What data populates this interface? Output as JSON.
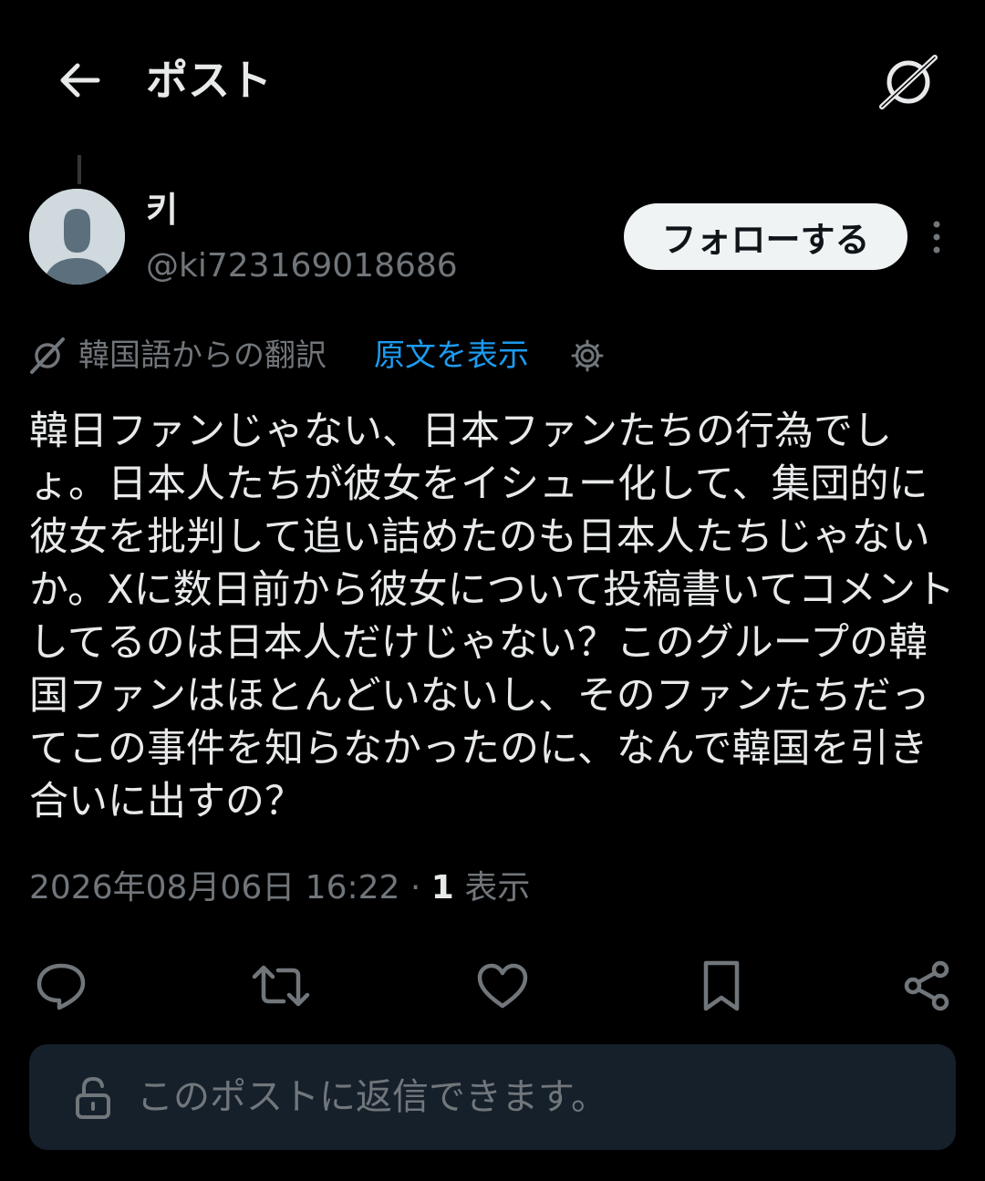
{
  "header": {
    "title": "ポスト",
    "back_icon": "arrow-left-icon",
    "grok_icon": "grok-icon"
  },
  "author": {
    "display_name": "키",
    "handle": "@ki723169018686",
    "follow_label": "フォローする",
    "more_icon": "more-vertical-icon"
  },
  "translation": {
    "label": "韓国語からの翻訳",
    "show_original": "原文を表示",
    "settings_icon": "gear-icon"
  },
  "post": {
    "text": "韓日ファンじゃない、日本ファンたちの行為でしょ。日本人たちが彼女をイシュー化して、集団的に彼女を批判して追い詰めたのも日本人たちじゃないか。Xに数日前から彼女について投稿書いてコメントしてるのは日本人だけじゃない？このグループの韓国ファンはほとんどいないし、そのファンたちだってこの事件を知らなかったのに、なんで韓国を引き合いに出すの？",
    "timestamp": "2026年08月06日 16:22",
    "separator": "·",
    "views_count": "1",
    "views_label": "表示"
  },
  "actions": {
    "reply_icon": "reply-icon",
    "repost_icon": "repost-icon",
    "like_icon": "heart-icon",
    "bookmark_icon": "bookmark-icon",
    "share_icon": "share-icon"
  },
  "reply_bar": {
    "text": "このポストに返信できます。",
    "icon": "lock-icon"
  },
  "colors": {
    "background": "#000000",
    "text_primary": "#e7e9ea",
    "text_secondary": "#71767b",
    "accent": "#1d9bf0",
    "reply_bar_bg": "#15202b"
  }
}
